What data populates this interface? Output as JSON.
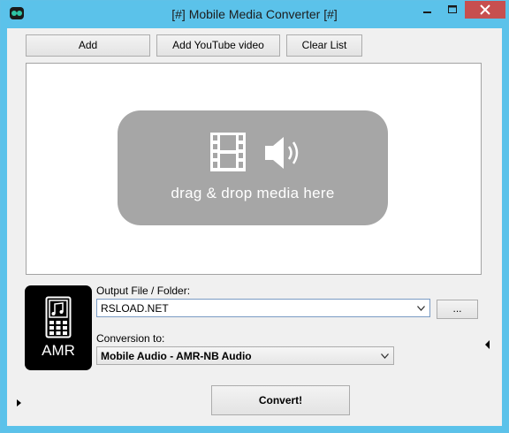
{
  "window": {
    "title": "[#] Mobile Media Converter [#]"
  },
  "toolbar": {
    "add_label": "Add",
    "add_youtube_label": "Add YouTube video",
    "clear_list_label": "Clear List"
  },
  "drop_zone": {
    "text": "drag & drop media here"
  },
  "format_tile": {
    "label": "AMR"
  },
  "output": {
    "label": "Output File / Folder:",
    "value": "RSLOAD.NET",
    "browse_label": "..."
  },
  "conversion": {
    "label": "Conversion to:",
    "selected": "Mobile Audio - AMR-NB Audio"
  },
  "convert_label": "Convert!",
  "icons": {
    "app": "app-icon",
    "minimize": "minimize-icon",
    "maximize": "maximize-icon",
    "close": "close-icon",
    "film": "film-icon",
    "speaker": "speaker-icon",
    "phone_music": "phone-music-icon",
    "expand_left": "expand-left-icon",
    "expand_right": "expand-right-icon"
  },
  "colors": {
    "frame": "#5bc2ea",
    "close_button": "#c74f4f",
    "drop_zone": "#a6a6a6"
  }
}
